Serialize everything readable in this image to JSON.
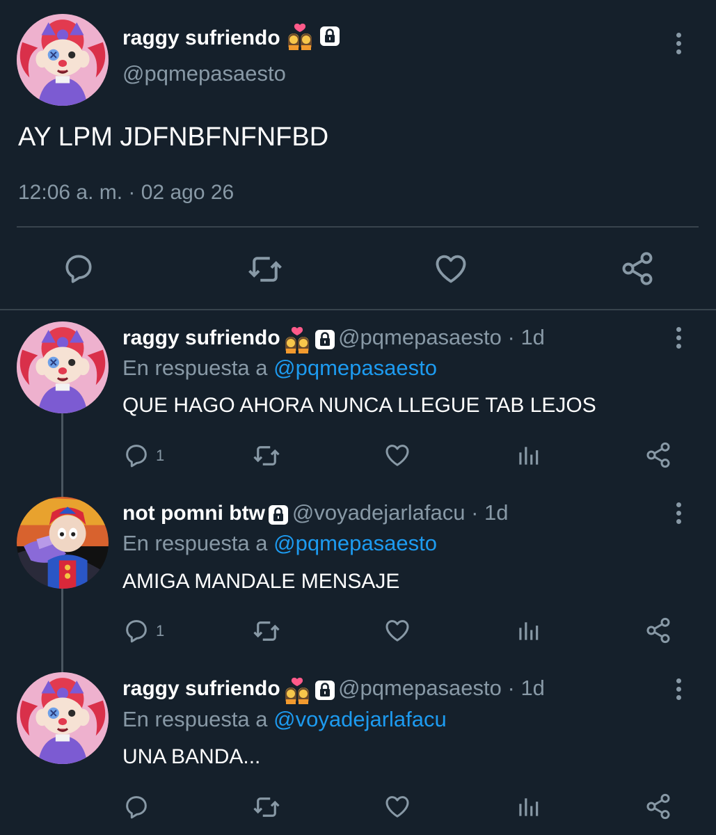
{
  "colors": {
    "background": "#15202b",
    "text": "#ffffff",
    "muted": "#8899a6",
    "link": "#1d9bf0",
    "divider": "#38444d"
  },
  "main_tweet": {
    "display_name": "raggy sufriendo",
    "handle": "@pqmepasaesto",
    "text": "AY LPM JDFNBFNFNFBD",
    "timestamp": "12:06 a. m. · 02 ago 26",
    "badges": [
      "couple-emoji-icon",
      "lock-icon"
    ]
  },
  "replies": [
    {
      "display_name": "raggy sufriendo",
      "handle_time": "@pqmepasaesto · 1d",
      "reply_prefix": "En respuesta a ",
      "reply_to": "@pqmepasaesto",
      "text": "QUE HAGO AHORA NUNCA LLEGUE TAB LEJOS",
      "reply_count": "1"
    },
    {
      "display_name": "not pomni btw",
      "handle_time": "@voyadejarlafacu · 1d",
      "reply_prefix": "En respuesta a ",
      "reply_to": "@pqmepasaesto",
      "text": "AMIGA MANDALE MENSAJE",
      "reply_count": "1"
    },
    {
      "display_name": "raggy sufriendo",
      "handle_time": "@pqmepasaesto · 1d",
      "reply_prefix": "En respuesta a ",
      "reply_to": "@voyadejarlafacu",
      "text": "UNA BANDA...",
      "reply_count": ""
    }
  ]
}
